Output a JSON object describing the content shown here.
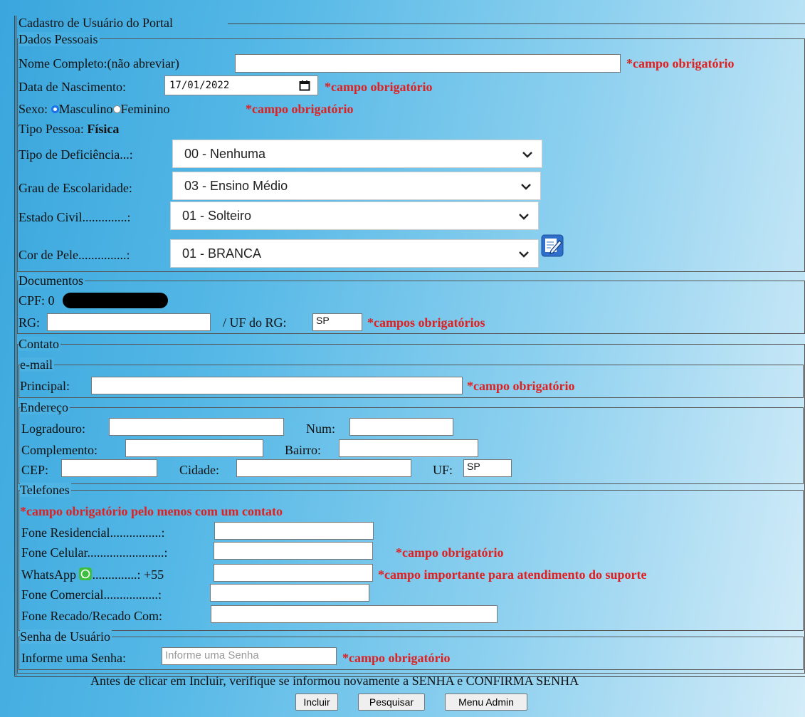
{
  "form": {
    "title": "Cadastro de Usuário do Portal",
    "footer_note": "Antes de clicar em Incluir, verifique se informou novamente a SENHA e CONFIRMA SENHA",
    "buttons": {
      "incluir": "Incluir",
      "pesquisar": "Pesquisar",
      "menu_admin": "Menu Admin"
    }
  },
  "dados_pessoais": {
    "legend": "Dados Pessoais",
    "nome_label": "Nome Completo:(não abreviar)",
    "nome_value": "",
    "nome_req": "*campo obrigatório",
    "nascimento_label": "Data de Nascimento:",
    "nascimento_value": "17/01/2022",
    "nascimento_req": "*campo obrigatório",
    "sexo_label": "Sexo:",
    "sexo_masculino": "Masculino",
    "sexo_feminino": "Feminino",
    "sexo_selected": "Masculino",
    "sexo_req": "*campo obrigatório",
    "tipo_pessoa_label": "Tipo Pessoa:",
    "tipo_pessoa_value": "Física",
    "deficiencia_label": "Tipo de Deficiência...:",
    "deficiencia_value": "00 - Nenhuma",
    "escolaridade_label": "Grau de Escolaridade:",
    "escolaridade_value": "03 - Ensino Médio",
    "estado_civil_label": "Estado Civil..............:",
    "estado_civil_value": "01 - Solteiro",
    "cor_pele_label": "Cor de Pele...............:",
    "cor_pele_value": "01 - BRANCA"
  },
  "documentos": {
    "legend": "Documentos",
    "cpf_label": "CPF: 0",
    "rg_label": "RG:",
    "rg_value": "",
    "uf_rg_label": "/ UF do RG:",
    "uf_rg_value": "SP",
    "req": "*campos obrigatórios"
  },
  "contato": {
    "legend": "Contato",
    "email_legend": "e-mail",
    "principal_label": "Principal:",
    "principal_value": "",
    "principal_req": "*campo obrigatório",
    "endereco_legend": "Endereço",
    "logradouro_label": "Logradouro:",
    "num_label": "Num:",
    "complemento_label": "Complemento:",
    "bairro_label": "Bairro:",
    "cep_label": "CEP:",
    "cidade_label": "Cidade:",
    "uf_label": "UF:",
    "uf_value": "SP",
    "telefones_legend": "Telefones",
    "telefones_req": "*campo obrigatório pelo menos com um contato",
    "fone_residencial_label": "Fone Residencial................:",
    "fone_celular_label": "Fone Celular........................:",
    "fone_celular_req": "*campo obrigatório",
    "whatsapp_label": "WhatsApp",
    "whatsapp_dots": "..............: +55",
    "whatsapp_req": "*campo importante para atendimento do suporte",
    "fone_comercial_label": "Fone Comercial.................:",
    "fone_recado_label": "Fone Recado/Recado Com:"
  },
  "senha": {
    "legend": "Senha de Usuário",
    "label": "Informe uma Senha:",
    "placeholder": "Informe uma Senha",
    "req": "*campo obrigatório"
  },
  "icons": {
    "select_arrow": "chevron-down-icon",
    "edit": "edit-note-icon",
    "whatsapp": "whatsapp-icon"
  },
  "colors": {
    "required": "#e02020",
    "selected_radio": "#1a73e8"
  }
}
